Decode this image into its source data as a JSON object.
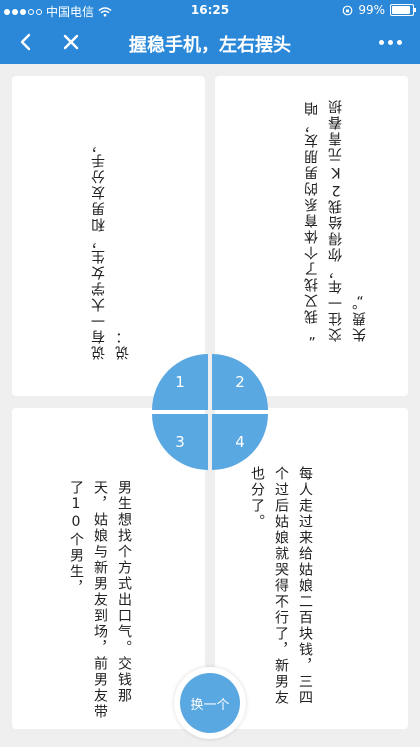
{
  "status_bar": {
    "carrier": "中国电信",
    "time": "16:25",
    "battery": "99%"
  },
  "navbar": {
    "title": "握稳手机，左右摆头"
  },
  "cards": [
    {
      "text": "说有一大学女生，和男友分手，说："
    },
    {
      "text": "“我又找了个体育系的男朋友，咱交往一年，你得给我2K元青春损失费。”"
    },
    {
      "text": "男生想找个方式出口气。交钱那天，姑娘与新男友到场，前男友带了10个男生，"
    },
    {
      "text": "每人走过来给姑娘二百块钱，三四个过后姑娘就哭得不行了，新男友也分了。"
    }
  ],
  "quadrants": [
    "1",
    "2",
    "3",
    "4"
  ],
  "swap_button": "换一个",
  "colors": {
    "brand_blue": "#2b88d8",
    "circle_blue": "#5aa8e1"
  }
}
